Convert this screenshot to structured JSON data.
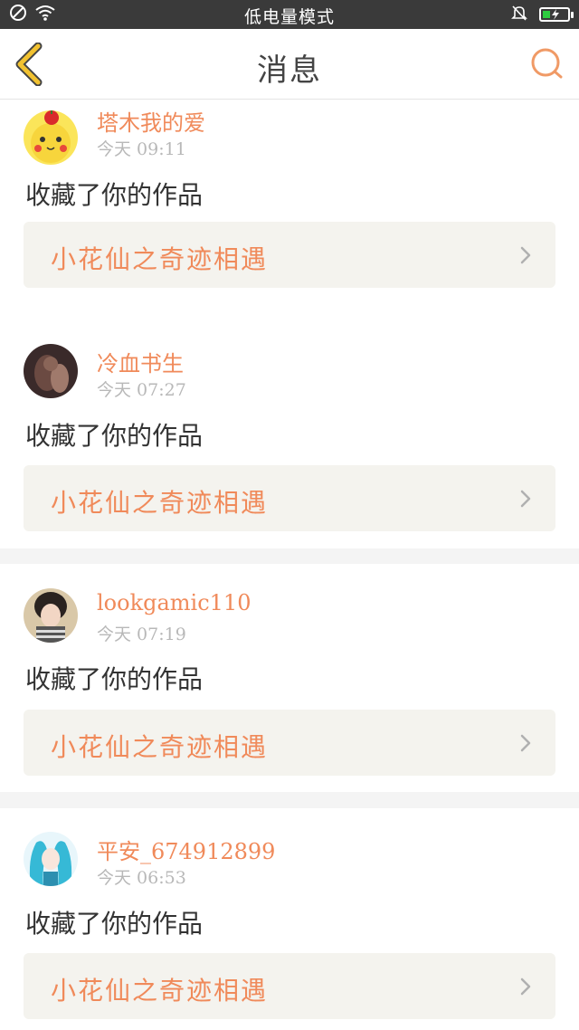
{
  "status_bar": {
    "title": "低电量模式",
    "icons": [
      "dnd-icon",
      "wifi-icon",
      "silent-bell-icon",
      "battery-charging-icon"
    ]
  },
  "nav": {
    "title": "消息",
    "back_icon": "chevron-left-icon",
    "search_icon": "search-icon"
  },
  "colors": {
    "accent": "#f08a5a",
    "back_icon": "#f2c230",
    "background": "#f4f4f4",
    "status_bar": "#3a3a3a"
  },
  "messages": [
    {
      "username": "塔木我的爱",
      "time": "今天 09:11",
      "action": "收藏了你的作品",
      "work_title": "小花仙之奇迹相遇",
      "avatar": "pikachu-avatar"
    },
    {
      "username": "冷血书生",
      "time": "今天 07:27",
      "action": "收藏了你的作品",
      "work_title": "小花仙之奇迹相遇",
      "avatar": "dark-photo-avatar"
    },
    {
      "username": "lookgamic110",
      "time": "今天 07:19",
      "action": "收藏了你的作品",
      "work_title": "小花仙之奇迹相遇",
      "avatar": "girl-photo-avatar"
    },
    {
      "username": "平安_674912899",
      "time": "今天 06:53",
      "action": "收藏了你的作品",
      "work_title": "小花仙之奇迹相遇",
      "avatar": "anime-character-avatar"
    }
  ]
}
